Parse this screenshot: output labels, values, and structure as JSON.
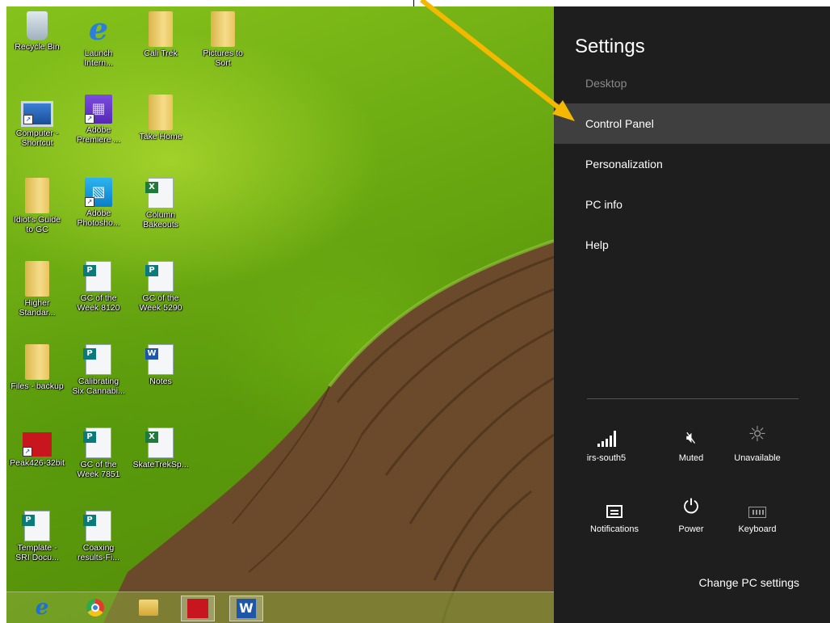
{
  "desktop": {
    "icons": [
      {
        "label": "Recycle Bin"
      },
      {
        "label": "Launch\nIntern..."
      },
      {
        "label": "Cali Trek"
      },
      {
        "label": "Pictures to\nSort"
      },
      {
        "label": "Computer -\nShortcut"
      },
      {
        "label": "Adobe\nPremiere ..."
      },
      {
        "label": "Take Home"
      },
      {
        "label": "Idiot's Guide\nto GC"
      },
      {
        "label": "Adobe\nPhotosho..."
      },
      {
        "label": "Column\nBakeouts"
      },
      {
        "label": "Higher\nStandar..."
      },
      {
        "label": "GC of the\nWeek 8120"
      },
      {
        "label": "GC of the\nWeek 5290"
      },
      {
        "label": "Files - backup"
      },
      {
        "label": "Calibrating\nSix Cannabi..."
      },
      {
        "label": "Notes"
      },
      {
        "label": "Peak426-32bit"
      },
      {
        "label": "GC of the\nWeek 7851"
      },
      {
        "label": "SkateTrekSp..."
      },
      {
        "label": "Template -\nSRI Docu..."
      },
      {
        "label": "Coaxing\nresults-Fi..."
      }
    ],
    "icon_types": [
      "recycle-bin-icon",
      "internet-explorer-icon",
      "folder-icon",
      "folder-icon",
      "computer-icon",
      "premiere-icon",
      "folder-icon",
      "folder-icon",
      "photoshop-icon",
      "excel-icon",
      "folder-icon",
      "publisher-icon",
      "publisher-icon",
      "folder-icon",
      "publisher-icon",
      "word-icon",
      "peak-app-icon",
      "publisher-icon",
      "excel-icon",
      "publisher-icon",
      "publisher-icon"
    ],
    "icon_badges": [
      "",
      "",
      "",
      "",
      "",
      "",
      "",
      "",
      "",
      "X",
      "",
      "P",
      "P",
      "",
      "P",
      "W",
      "",
      "P",
      "X",
      "P",
      "P"
    ]
  },
  "taskbar": {
    "items": [
      "internet-explorer-icon",
      "chrome-icon",
      "file-explorer-icon",
      "peak-app-icon",
      "word-icon"
    ],
    "word_glyph": "W",
    "ie_glyph": "e"
  },
  "settings": {
    "title": "Settings",
    "menu": [
      {
        "label": "Desktop",
        "state": "disabled"
      },
      {
        "label": "Control Panel",
        "state": "hover"
      },
      {
        "label": "Personalization",
        "state": "normal"
      },
      {
        "label": "PC info",
        "state": "normal"
      },
      {
        "label": "Help",
        "state": "normal"
      }
    ],
    "quick_tiles": [
      {
        "label": "irs-south5",
        "icon": "wifi-signal-icon",
        "glyph": ""
      },
      {
        "label": "Muted",
        "icon": "volume-muted-icon",
        "glyph": "🔇︎"
      },
      {
        "label": "Unavailable",
        "icon": "brightness-icon",
        "glyph": "☼"
      },
      {
        "label": "Notifications",
        "icon": "notifications-icon",
        "glyph": ""
      },
      {
        "label": "Power",
        "icon": "power-icon",
        "glyph": "⏻"
      },
      {
        "label": "Keyboard",
        "icon": "keyboard-icon",
        "glyph": ""
      }
    ],
    "change_link": "Change PC settings"
  },
  "colors": {
    "charm_bg": "#1e1e1e",
    "hover_bg": "#3f3f3f",
    "arrow": "#f5b800",
    "disabled_text": "#8a8a8a"
  }
}
